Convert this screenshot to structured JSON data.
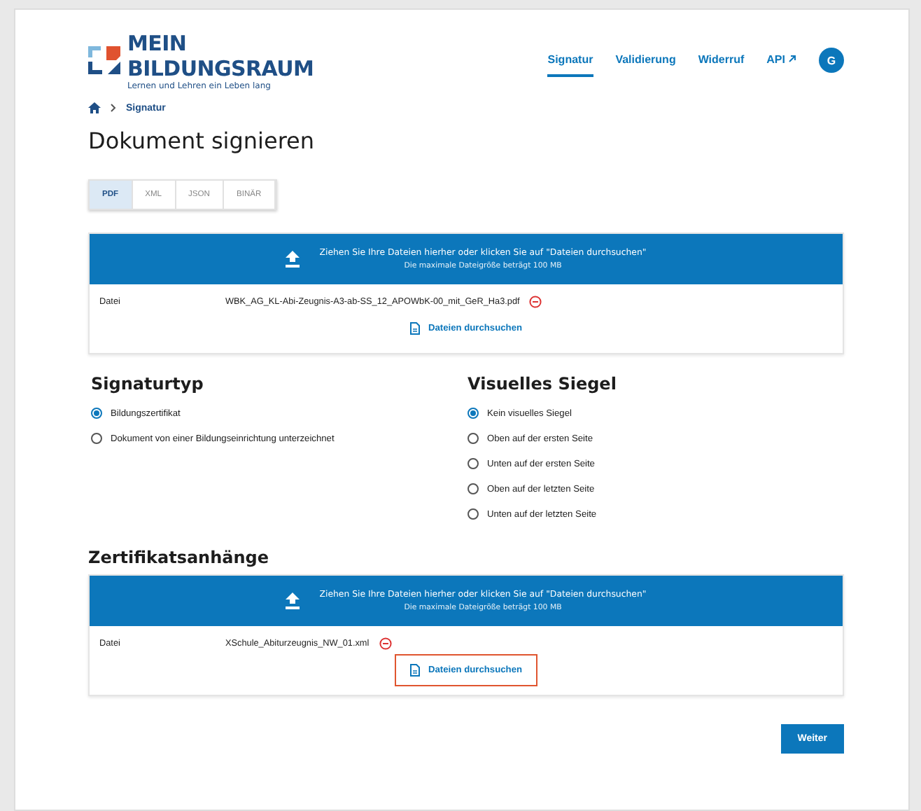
{
  "logo": {
    "line1": "MEIN",
    "line2": "BILDUNGSRAUM",
    "tagline": "Lernen und Lehren ein Leben lang"
  },
  "nav": [
    {
      "label": "Signatur",
      "selected": true,
      "external": false
    },
    {
      "label": "Validierung",
      "selected": false,
      "external": false
    },
    {
      "label": "Widerruf",
      "selected": false,
      "external": false
    },
    {
      "label": "API",
      "selected": false,
      "external": true
    }
  ],
  "avatar": "G",
  "breadcrumb": [
    "Signatur"
  ],
  "title": "Dokument signieren",
  "format_tabs": [
    {
      "label": "PDF",
      "selected": true
    },
    {
      "label": "XML",
      "selected": false
    },
    {
      "label": "JSON",
      "selected": false
    },
    {
      "label": "BINÄR",
      "selected": false
    }
  ],
  "uploads": [
    {
      "drop_text": "Ziehen Sie Ihre Dateien hierher oder klicken Sie auf \"Dateien durchsuchen\"",
      "drop_hint": "Die maximale Dateigröße beträgt 100 MB",
      "file_label": "Datei",
      "file_name": "WBK_AG_KL-Abi-Zeugnis-A3-ab-SS_12_APOWbK-00_mit_GeR_Ha3.pdf",
      "browse": "Dateien durchsuchen",
      "highlighted": false
    },
    {
      "heading": "Zertifikatsanhänge",
      "drop_text": "Ziehen Sie Ihre Dateien hierher oder klicken Sie auf \"Dateien durchsuchen\"",
      "drop_hint": "Die maximale Dateigröße beträgt 100 MB",
      "file_label": "Datei",
      "file_name": "XSchule_Abiturzeugnis_NW_01.xml",
      "browse": "Dateien durchsuchen",
      "highlighted": true
    }
  ],
  "groups": [
    {
      "heading": "Signaturtyp",
      "options": [
        {
          "label": "Bildungszertifikat",
          "selected": true
        },
        {
          "label": "Dokument von einer Bildungseinrichtung unterzeichnet",
          "selected": false
        }
      ]
    },
    {
      "heading": "Visuelles Siegel",
      "options": [
        {
          "label": "Kein visuelles Siegel",
          "selected": true
        },
        {
          "label": "Oben auf der ersten Seite",
          "selected": false
        },
        {
          "label": "Unten auf der ersten Seite",
          "selected": false
        },
        {
          "label": "Oben auf der letzten Seite",
          "selected": false
        },
        {
          "label": "Unten auf der letzten Seite",
          "selected": false
        }
      ]
    }
  ],
  "next_button": "Weiter"
}
